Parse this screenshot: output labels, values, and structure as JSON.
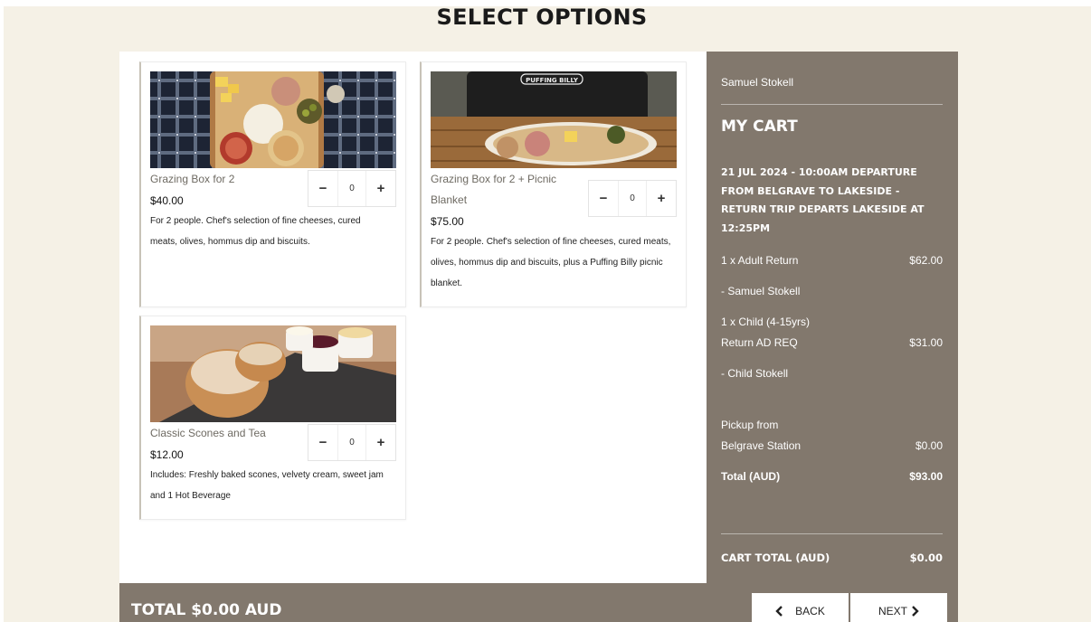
{
  "page_title": "SELECT OPTIONS",
  "products": [
    {
      "name": "Grazing Box for 2",
      "price": "$40.00",
      "description": "For 2 people. Chef's selection of fine cheeses, cured meats, olives, hommus dip and biscuits.",
      "quantity": "0",
      "decrement_label": "−",
      "increment_label": "+"
    },
    {
      "name": "Grazing Box for 2 + Picnic Blanket",
      "price": "$75.00",
      "description": "For 2 people. Chef's selection of fine cheeses, cured meats, olives, hommus dip and biscuits, plus a Puffing Billy picnic blanket.",
      "quantity": "0",
      "decrement_label": "−",
      "increment_label": "+",
      "image_brand_text": "PUFFING BILLY"
    },
    {
      "name": "Classic Scones and Tea",
      "price": "$12.00",
      "description": "Includes: Freshly baked scones, velvety cream, sweet jam and 1 Hot Beverage",
      "quantity": "0",
      "decrement_label": "−",
      "increment_label": "+"
    }
  ],
  "cart": {
    "user_name": "Samuel Stokell",
    "heading": "MY CART",
    "trip_details": "21 JUL 2024 - 10:00AM DEPARTURE FROM BELGRAVE TO LAKESIDE - RETURN TRIP DEPARTS LAKESIDE AT 12:25PM",
    "items": [
      {
        "label": "1 x Adult Return",
        "amount": "$62.00"
      },
      {
        "label": "- Samuel Stokell",
        "amount": ""
      },
      {
        "label_line1": "1 x Child (4-15yrs)",
        "label_line2": "Return AD REQ",
        "amount": "$31.00"
      },
      {
        "label": "- Child Stokell",
        "amount": ""
      },
      {
        "label_line1": "Pickup from",
        "label_line2": "Belgrave Station",
        "amount": "$0.00"
      }
    ],
    "total_label": "Total (AUD)",
    "total_amount": "$93.00",
    "cart_total_label": "CART TOTAL (AUD)",
    "cart_total_amount": "$0.00"
  },
  "footer": {
    "grand_total": "TOTAL $0.00 AUD",
    "back_label": "BACK",
    "next_label": "NEXT",
    "back_icon": "chevron-left-icon",
    "next_icon": "chevron-right-icon"
  },
  "colors": {
    "page_background": "#f5f1e6",
    "cart_background": "#82786d",
    "product_name": "#6e6a62"
  }
}
